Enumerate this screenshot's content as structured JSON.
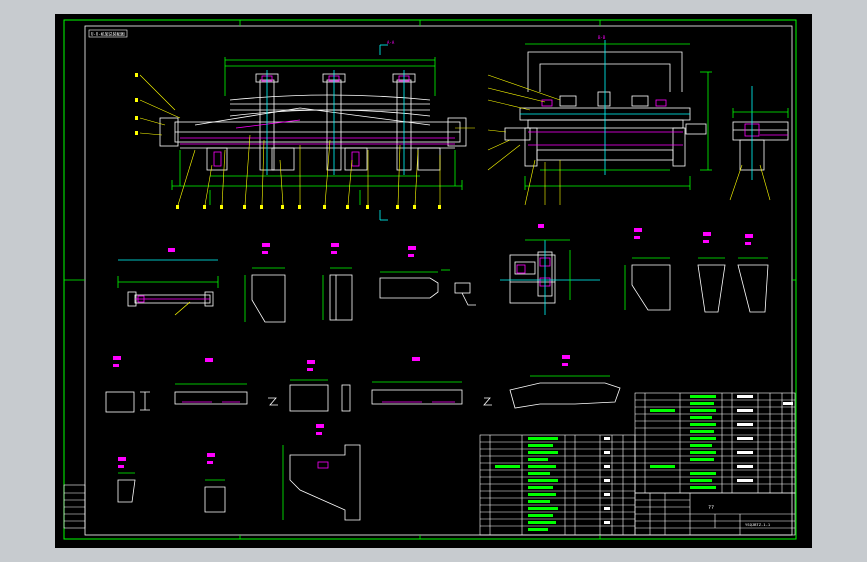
{
  "drawing": {
    "title_tag": "U-U-机架总装配图",
    "section_label_top": "A-A",
    "section_label_right": "B-B",
    "title_block_main": "??",
    "title_block_code": "YSQJBTZ-1-1"
  },
  "colors": {
    "background": "#000000",
    "surround": "#c7cbcf",
    "frame": "#00ff00",
    "border": "#ffffff",
    "outline": "#ffffff",
    "dimension": "#00ff00",
    "hidden": "#ff00ff",
    "leader": "#ffff00",
    "title": "#ff00ff",
    "center": "#00ffff"
  }
}
